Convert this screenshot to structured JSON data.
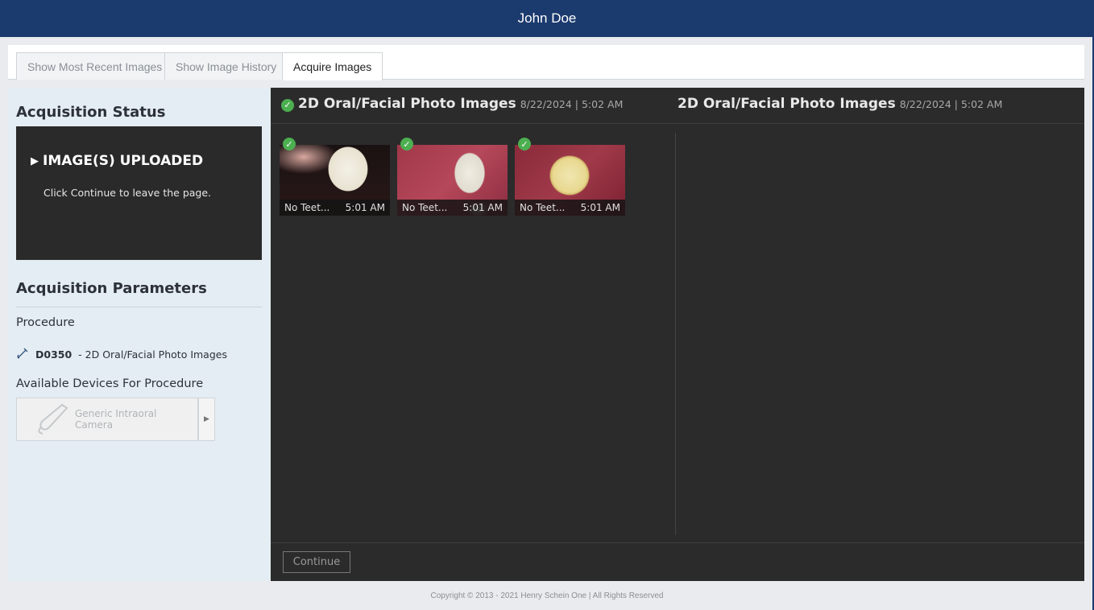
{
  "header": {
    "patient_name": "John Doe"
  },
  "tabs": [
    {
      "label": "Show Most Recent Images"
    },
    {
      "label": "Show Image History"
    },
    {
      "label": "Acquire Images"
    }
  ],
  "left": {
    "status_title": "Acquisition Status",
    "status": "IMAGE(S) UPLOADED",
    "status_message": "Click Continue to leave the page.",
    "params_title": "Acquisition Parameters",
    "procedure_label": "Procedure",
    "procedure_code": "D0350",
    "procedure_desc": "- 2D Oral/Facial Photo Images",
    "devices_label": "Available Devices For Procedure",
    "device_name": "Generic Intraoral Camera"
  },
  "main": {
    "left_title": "2D Oral/Facial Photo Images",
    "left_date": "8/22/2024 | 5:02 AM",
    "right_title": "2D Oral/Facial Photo Images",
    "right_date": "8/22/2024 | 5:02 AM",
    "thumbnails": [
      {
        "label": "No Teet...",
        "time": "5:01 AM"
      },
      {
        "label": "No Teet...",
        "time": "5:01 AM"
      },
      {
        "label": "No Teet...",
        "time": "5:01 AM"
      }
    ],
    "continue_label": "Continue"
  },
  "footer": {
    "copyright": "Copyright © 2013 - 2021 Henry Schein One | All Rights Reserved"
  },
  "colors": {
    "topbar": "#1b3a6e",
    "panel": "#2b2b2b",
    "success": "#4caf50"
  }
}
